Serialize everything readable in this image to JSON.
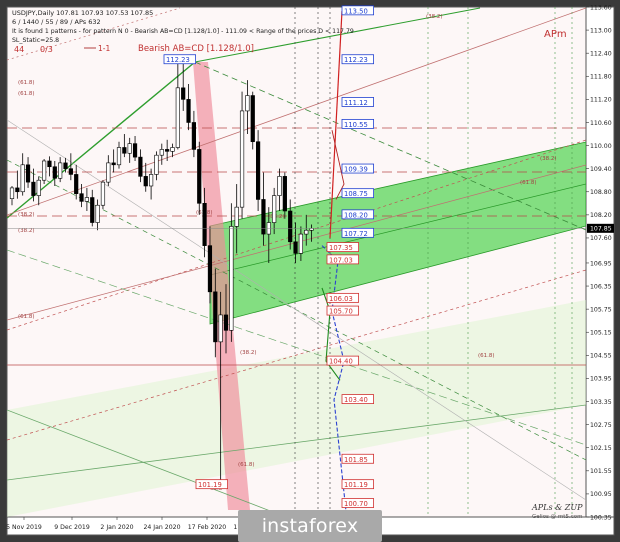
{
  "header": {
    "line1": "USDJPY,Daily  107.81 107.93 107.53 107.85",
    "line2": "6 / 1440 / 55 / 89 / APs 632",
    "line3": "It is found 1 patterns  -  for pattern N 0 - Bearish AB=CD [1.128/1.0] - 111.09 < Range of the prices D < 117.79",
    "line4": "SL_Static=25.8",
    "counts_left": "44",
    "counts_right": "0/3",
    "legend_line": "1-1",
    "pattern_label": "Bearish AB=CD [1.128/1.0]"
  },
  "top_right_label": "APm",
  "signature": {
    "line1": "APLs & ZUP",
    "line2": "Gelios @ mt5.com"
  },
  "watermark": "instaforex",
  "colors": {
    "background": "#fdf7f7",
    "green_channel": "#3fd43f",
    "candles": "#000000",
    "red_bar": "#f08a9a",
    "blue_label": "#2040d0",
    "red_label": "#d03030"
  },
  "chart_data": {
    "type": "candlestick",
    "symbol": "USDJPY",
    "timeframe": "Daily",
    "ylim": [
      100.35,
      113.6
    ],
    "y_ticks": [
      "113.60",
      "113.00",
      "112.40",
      "111.80",
      "111.20",
      "110.60",
      "110.00",
      "109.40",
      "108.80",
      "108.20",
      "107.60",
      "106.95",
      "106.35",
      "105.75",
      "105.15",
      "104.55",
      "103.95",
      "103.35",
      "102.75",
      "102.15",
      "101.55",
      "100.95",
      "100.35"
    ],
    "x_ticks": [
      "5 Nov 2019",
      "9 Dec 2019",
      "2 Jan 2020",
      "24 Jan 2020",
      "17 Feb 2020",
      "11 Mar 2020"
    ],
    "current_price": "107.85",
    "price_levels_blue": [
      "113.50",
      "112.23",
      "111.12",
      "110.55",
      "109.39",
      "108.75",
      "108.20",
      "107.72"
    ],
    "price_levels_red": [
      "107.35",
      "107.03",
      "106.03",
      "105.70",
      "104.40",
      "103.40",
      "101.85",
      "101.19",
      "100.70"
    ],
    "left_level_labels": [
      "112.23",
      "101.19"
    ],
    "channel_labels": [
      "(61.8)",
      "(61.8)",
      "(38.2)",
      "(38.2)",
      "(61.8)",
      "(61.8)",
      "(38.2)",
      "(38.2)",
      "61.8",
      "(61.8)",
      "(38.2)",
      "(61.8)",
      "(61.8)",
      "(38.2)"
    ],
    "ohlc": [
      {
        "o": 108.62,
        "h": 108.95,
        "l": 108.45,
        "c": 108.9
      },
      {
        "o": 108.9,
        "h": 109.35,
        "l": 108.62,
        "c": 108.8
      },
      {
        "o": 108.8,
        "h": 109.8,
        "l": 108.7,
        "c": 109.5
      },
      {
        "o": 109.5,
        "h": 109.7,
        "l": 108.9,
        "c": 109.05
      },
      {
        "o": 109.05,
        "h": 109.4,
        "l": 108.55,
        "c": 108.7
      },
      {
        "o": 108.7,
        "h": 109.2,
        "l": 108.45,
        "c": 109.1
      },
      {
        "o": 109.1,
        "h": 109.65,
        "l": 109.0,
        "c": 109.6
      },
      {
        "o": 109.6,
        "h": 109.72,
        "l": 109.2,
        "c": 109.45
      },
      {
        "o": 109.45,
        "h": 109.6,
        "l": 108.95,
        "c": 109.15
      },
      {
        "o": 109.15,
        "h": 109.7,
        "l": 109.05,
        "c": 109.55
      },
      {
        "o": 109.55,
        "h": 109.68,
        "l": 109.3,
        "c": 109.4
      },
      {
        "o": 109.4,
        "h": 109.8,
        "l": 109.1,
        "c": 109.25
      },
      {
        "o": 109.25,
        "h": 109.5,
        "l": 108.6,
        "c": 108.75
      },
      {
        "o": 108.75,
        "h": 109.0,
        "l": 108.4,
        "c": 108.55
      },
      {
        "o": 108.55,
        "h": 108.9,
        "l": 108.3,
        "c": 108.65
      },
      {
        "o": 108.65,
        "h": 108.85,
        "l": 107.9,
        "c": 108.0
      },
      {
        "o": 108.0,
        "h": 108.6,
        "l": 107.8,
        "c": 108.45
      },
      {
        "o": 108.45,
        "h": 109.1,
        "l": 108.35,
        "c": 109.05
      },
      {
        "o": 109.05,
        "h": 109.75,
        "l": 108.95,
        "c": 109.55
      },
      {
        "o": 109.55,
        "h": 109.9,
        "l": 109.3,
        "c": 109.5
      },
      {
        "o": 109.5,
        "h": 110.1,
        "l": 109.4,
        "c": 109.95
      },
      {
        "o": 109.95,
        "h": 110.3,
        "l": 109.7,
        "c": 109.8
      },
      {
        "o": 109.8,
        "h": 110.2,
        "l": 109.55,
        "c": 110.05
      },
      {
        "o": 110.05,
        "h": 110.25,
        "l": 109.6,
        "c": 109.7
      },
      {
        "o": 109.7,
        "h": 109.9,
        "l": 109.05,
        "c": 109.2
      },
      {
        "o": 109.2,
        "h": 109.55,
        "l": 108.8,
        "c": 108.95
      },
      {
        "o": 108.95,
        "h": 109.4,
        "l": 108.6,
        "c": 109.25
      },
      {
        "o": 109.25,
        "h": 109.85,
        "l": 109.1,
        "c": 109.75
      },
      {
        "o": 109.75,
        "h": 110.05,
        "l": 109.5,
        "c": 109.9
      },
      {
        "o": 109.9,
        "h": 110.15,
        "l": 109.6,
        "c": 109.85
      },
      {
        "o": 109.85,
        "h": 110.05,
        "l": 109.7,
        "c": 109.95
      },
      {
        "o": 109.95,
        "h": 112.2,
        "l": 109.9,
        "c": 111.5
      },
      {
        "o": 111.5,
        "h": 112.23,
        "l": 110.9,
        "c": 111.2
      },
      {
        "o": 111.2,
        "h": 111.6,
        "l": 110.4,
        "c": 110.6
      },
      {
        "o": 110.6,
        "h": 110.9,
        "l": 109.7,
        "c": 109.9
      },
      {
        "o": 109.9,
        "h": 110.1,
        "l": 108.2,
        "c": 108.5
      },
      {
        "o": 108.5,
        "h": 108.9,
        "l": 107.1,
        "c": 107.4
      },
      {
        "o": 107.4,
        "h": 107.9,
        "l": 105.9,
        "c": 106.2
      },
      {
        "o": 106.2,
        "h": 106.8,
        "l": 104.5,
        "c": 104.9
      },
      {
        "o": 104.9,
        "h": 106.2,
        "l": 101.19,
        "c": 105.6
      },
      {
        "o": 105.6,
        "h": 106.4,
        "l": 104.6,
        "c": 105.2
      },
      {
        "o": 105.2,
        "h": 108.5,
        "l": 104.9,
        "c": 107.9
      },
      {
        "o": 107.9,
        "h": 109.0,
        "l": 107.2,
        "c": 108.4
      },
      {
        "o": 108.4,
        "h": 111.4,
        "l": 108.1,
        "c": 110.9
      },
      {
        "o": 110.9,
        "h": 111.7,
        "l": 110.3,
        "c": 111.3
      },
      {
        "o": 111.3,
        "h": 111.4,
        "l": 109.9,
        "c": 110.1
      },
      {
        "o": 110.1,
        "h": 110.4,
        "l": 108.3,
        "c": 108.6
      },
      {
        "o": 108.6,
        "h": 109.3,
        "l": 107.4,
        "c": 107.7
      },
      {
        "o": 107.7,
        "h": 108.4,
        "l": 106.95,
        "c": 108.0
      },
      {
        "o": 108.0,
        "h": 108.9,
        "l": 107.7,
        "c": 108.7
      },
      {
        "o": 108.7,
        "h": 109.4,
        "l": 108.3,
        "c": 109.2
      },
      {
        "o": 109.2,
        "h": 109.3,
        "l": 108.1,
        "c": 108.3
      },
      {
        "o": 108.3,
        "h": 108.6,
        "l": 107.3,
        "c": 107.5
      },
      {
        "o": 107.5,
        "h": 108.0,
        "l": 106.95,
        "c": 107.2
      },
      {
        "o": 107.2,
        "h": 107.9,
        "l": 107.0,
        "c": 107.7
      },
      {
        "o": 107.7,
        "h": 108.2,
        "l": 107.4,
        "c": 107.8
      },
      {
        "o": 107.8,
        "h": 107.95,
        "l": 107.5,
        "c": 107.85
      }
    ]
  }
}
